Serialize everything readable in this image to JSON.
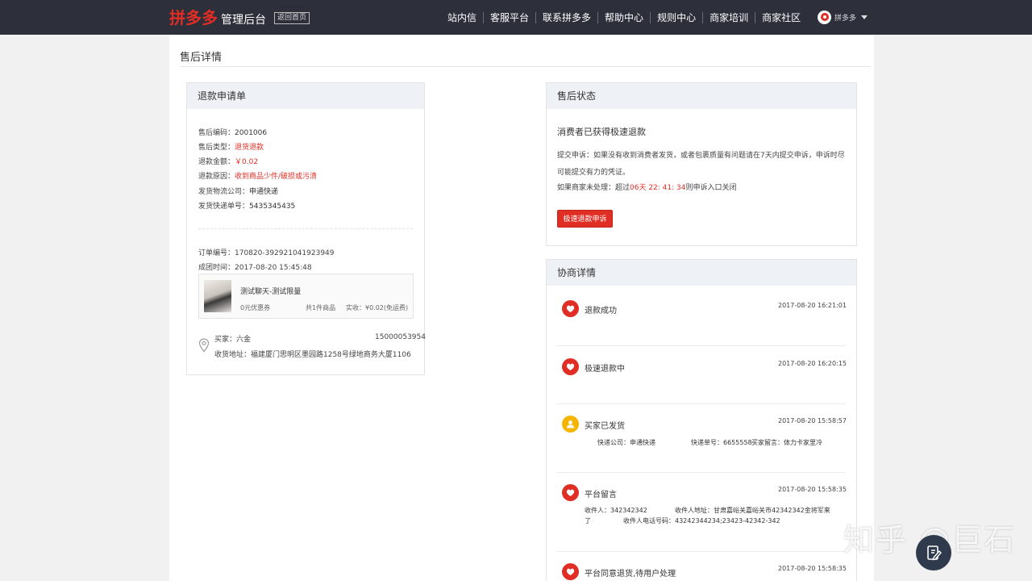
{
  "header": {
    "brand": "拼多多",
    "subtitle": "管理后台",
    "home_label": "返回首页",
    "nav": [
      "站内信",
      "客服平台",
      "联系拼多多",
      "帮助中心",
      "规则中心",
      "商家培训",
      "商家社区"
    ],
    "user_name": "拼多多",
    "accent": "#e02e24",
    "bg": "#2d2f3b"
  },
  "page": {
    "title": "售后详情"
  },
  "refund": {
    "heading": "退款申请单",
    "rows": [
      {
        "k": "售后编码：",
        "v": "2001006",
        "red": false
      },
      {
        "k": "售后类型：",
        "v": "退货退款",
        "red": true
      },
      {
        "k": "退款金额：",
        "v": "￥0.02",
        "red": true
      },
      {
        "k": "退款原因：",
        "v": "收到商品少件/破损或污渍",
        "red": true
      },
      {
        "k": "发货物流公司：",
        "v": "申通快递",
        "red": false
      },
      {
        "k": "发货快递单号：",
        "v": "5435345435",
        "red": false
      }
    ],
    "order_no": "订单编号：170820-392921041923949",
    "group_time": "成团时间：2017-08-20 15:45:48",
    "product": {
      "name": "测试聊天-测试限量",
      "coupon": "0元优惠券",
      "count": "共1件商品",
      "paid": "实收：¥0.02(免运费)"
    },
    "buyer": "买家：六金",
    "phone": "15000053954",
    "address": "收货地址：福建厦门思明区墨园路1258号绿地商务大厦1106"
  },
  "status": {
    "heading": "售后状态",
    "line1": "消费者已获得极速退款",
    "line2": "提交申诉：如果没有收到消费者发货，或者包裹质量有问题请在7天内提交申诉，申诉时尽可能提交有力的凭证。",
    "line3_pre": "如果商家未处理：超过",
    "line3_time": "06天 22: 41: 34",
    "line3_post": "则申诉入口关闭",
    "button": "极速退款申诉"
  },
  "negotiation": {
    "heading": "协商详情",
    "items": [
      {
        "title": "退款成功",
        "time": "2017-08-20 16:21:01",
        "icon": "pdd-logo-icon"
      },
      {
        "title": "极速退款中",
        "time": "2017-08-20 16:20:15",
        "icon": "pdd-logo-icon"
      },
      {
        "title": "买家已发货",
        "time": "2017-08-20 15:58:57",
        "icon": "user-icon",
        "d1": "快递公司：申通快递",
        "d2": "快递单号：6655558",
        "d3": "买家留言：体力卡家里冷"
      },
      {
        "title": "平台留言",
        "time": "2017-08-20 15:58:35",
        "icon": "pdd-logo-icon",
        "d1": "收件人：342342342",
        "d2": "收件人地址：甘肃嘉峪关嘉峪关市42342342金将军来",
        "d3": "了",
        "d4": "收件人电话号码：43242344234;23423-42342-342"
      },
      {
        "title": "平台同意退货,待用户处理",
        "time": "2017-08-20 15:58:35",
        "icon": "pdd-logo-icon"
      }
    ]
  },
  "watermark": "知乎 @巨石"
}
